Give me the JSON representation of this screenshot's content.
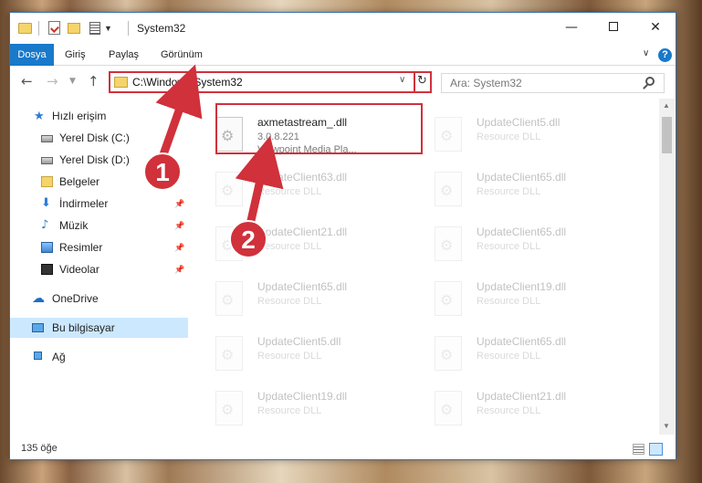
{
  "window": {
    "title": "System32",
    "controls": {
      "minimize": "—",
      "maximize": "",
      "close": "✕"
    }
  },
  "ribbon": {
    "tabs": [
      "Dosya",
      "Giriş",
      "Paylaş",
      "Görünüm"
    ],
    "help": "?"
  },
  "navbar": {
    "address": "C:\\Windows\\System32",
    "search_placeholder": "Ara: System32"
  },
  "sidebar": {
    "items": [
      {
        "label": "Hızlı erişim",
        "icon": "star-icon"
      },
      {
        "label": "Yerel Disk (C:)",
        "icon": "disk-icon"
      },
      {
        "label": "Yerel Disk (D:)",
        "icon": "disk-icon"
      },
      {
        "label": "Belgeler",
        "icon": "folder-icon"
      },
      {
        "label": "İndirmeler",
        "icon": "download-icon"
      },
      {
        "label": "Müzik",
        "icon": "music-icon"
      },
      {
        "label": "Resimler",
        "icon": "pictures-icon"
      },
      {
        "label": "Videolar",
        "icon": "videos-icon"
      },
      {
        "label": "OneDrive",
        "icon": "cloud-icon"
      },
      {
        "label": "Bu bilgisayar",
        "icon": "computer-icon"
      },
      {
        "label": "Ağ",
        "icon": "network-icon"
      }
    ]
  },
  "files": [
    {
      "name": "axmetastream_.dll",
      "line2": "3.0.8.221",
      "line3": "Viewpoint Media Pla..."
    },
    {
      "name": "UpdateClient5.dll",
      "line2": "Resource DLL",
      "line3": ""
    },
    {
      "name": "UpdateClient63.dll",
      "line2": "Resource DLL",
      "line3": ""
    },
    {
      "name": "UpdateClient65.dll",
      "line2": "Resource DLL",
      "line3": ""
    },
    {
      "name": "UpdateClient21.dll",
      "line2": "Resource DLL",
      "line3": ""
    },
    {
      "name": "UpdateClient65.dll",
      "line2": "Resource DLL",
      "line3": ""
    },
    {
      "name": "UpdateClient65.dll",
      "line2": "Resource DLL",
      "line3": ""
    },
    {
      "name": "UpdateClient19.dll",
      "line2": "Resource DLL",
      "line3": ""
    },
    {
      "name": "UpdateClient5.dll",
      "line2": "Resource DLL",
      "line3": ""
    },
    {
      "name": "UpdateClient65.dll",
      "line2": "Resource DLL",
      "line3": ""
    },
    {
      "name": "UpdateClient19.dll",
      "line2": "Resource DLL",
      "line3": ""
    },
    {
      "name": "UpdateClient21.dll",
      "line2": "Resource DLL",
      "line3": ""
    }
  ],
  "status": {
    "item_count": "135 öğe"
  },
  "annotations": {
    "step1": "1",
    "step2": "2",
    "color": "#d0313b"
  }
}
